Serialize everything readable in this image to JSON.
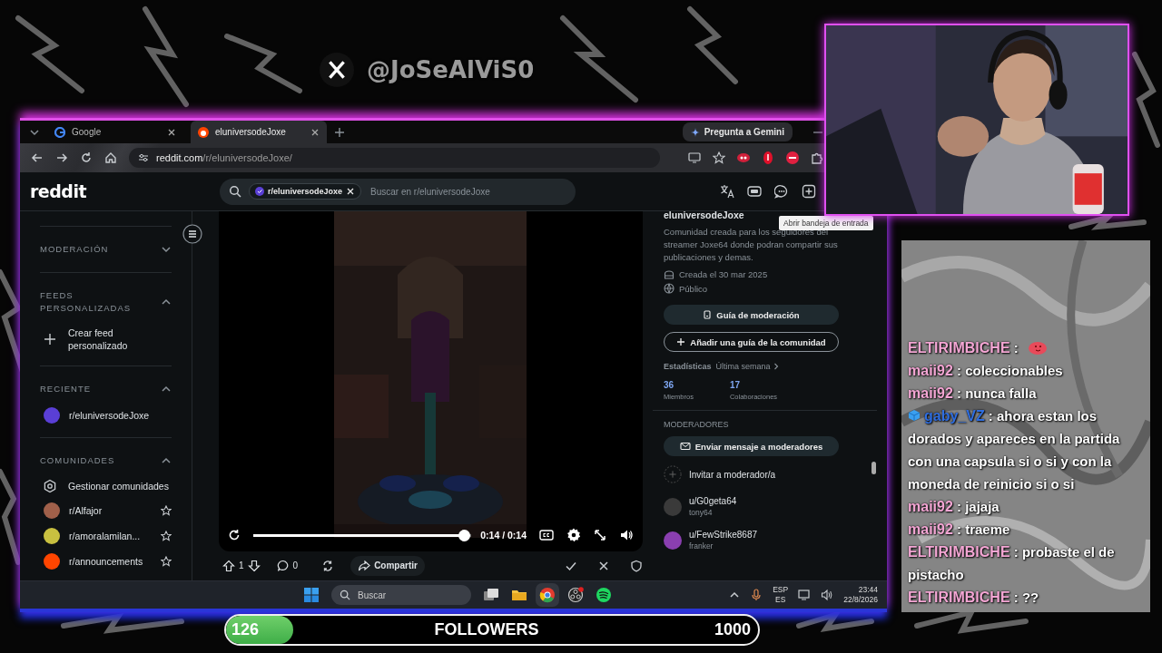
{
  "social": {
    "handle": "@JoSeAlViS0"
  },
  "browser": {
    "tabs": [
      {
        "title": "Google",
        "selected": false
      },
      {
        "title": "eluniversodeJoxe",
        "selected": true
      }
    ],
    "gemini": "Pregunta a Gemini",
    "url": {
      "domain": "reddit.com",
      "path": "/r/eluniversodeJoxe/"
    }
  },
  "reddit": {
    "logo": "reddit",
    "search": {
      "chip": "r/eluniversodeJoxe",
      "placeholder": "Buscar en r/eluniversodeJoxe"
    },
    "tooltip": "Abrir bandeja de entrada",
    "sidebar": [
      {
        "title": "MODERACIÓN",
        "expanded": false
      },
      {
        "title": "FEEDS PERSONALIZADAS",
        "expanded": true,
        "items": [
          {
            "kind": "add",
            "label": "Crear feed personalizado"
          }
        ]
      },
      {
        "title": "RECIENTE",
        "expanded": true,
        "items": [
          {
            "kind": "community",
            "label": "r/eluniversodeJoxe",
            "color": "#5a3fd6"
          }
        ]
      },
      {
        "title": "COMUNIDADES",
        "expanded": true,
        "items": [
          {
            "kind": "settings",
            "label": "Gestionar comunidades"
          },
          {
            "kind": "community",
            "label": "r/Alfajor",
            "color": "#a0604a",
            "favorite": false
          },
          {
            "kind": "community",
            "label": "r/amoralamilan...",
            "color": "#c8c040",
            "favorite": false
          },
          {
            "kind": "community",
            "label": "r/announcements",
            "color": "#ff4500",
            "favorite": false
          }
        ]
      }
    ],
    "video": {
      "time": "0:14 / 0:14",
      "level": 1.0
    },
    "post": {
      "votes": "1",
      "comments": "0",
      "share": "Compartir"
    },
    "about": {
      "name": "eluniversodeJoxe",
      "description": "Comunidad creada para los seguidores del streamer Joxe64 donde podran compartir sus publicaciones y demas.",
      "created": "Creada el 30 mar 2025",
      "visibility": "Público",
      "buttons": [
        {
          "label": "Guía de moderación",
          "kind": "filled"
        },
        {
          "label": "Añadir una guía de la comunidad",
          "kind": "outline"
        }
      ],
      "stats_label": "Estadísticas",
      "period": "Última semana",
      "stats": [
        {
          "value": "36",
          "label": "Miembros"
        },
        {
          "value": "17",
          "label": "Colaboraciones"
        }
      ],
      "moderators_title": "MODERADORES",
      "message_button": "Enviar mensaje a moderadores",
      "invite": "Invitar a moderador/a",
      "moderators": [
        {
          "user": "u/G0geta64",
          "flair": "tony64",
          "color": "#3a3a3a"
        },
        {
          "user": "u/FewStrike8687",
          "flair": "franker",
          "color": "#8a3fb0"
        }
      ]
    }
  },
  "taskbar": {
    "search": "Buscar",
    "lang": "ESP",
    "region": "ES",
    "time": "23:44",
    "date": "22/8/2026"
  },
  "chat": [
    {
      "user": "ELTIRIMBICHE",
      "color": "#f4a6d4",
      "text": ":",
      "emote": true
    },
    {
      "user": "maii92",
      "color": "#f4a6d4",
      "text": ": coleccionables"
    },
    {
      "user": "maii92",
      "color": "#f4a6d4",
      "text": ": nunca falla"
    },
    {
      "user": "gaby_VZ",
      "color": "#2f6ee0",
      "text": ": ahora estan los dorados y apareces en la partida con una capsula si o si y con la moneda de reinicio si o si",
      "badge": true
    },
    {
      "user": "maii92",
      "color": "#f4a6d4",
      "text": ": jajaja"
    },
    {
      "user": "maii92",
      "color": "#f4a6d4",
      "text": ": traeme"
    },
    {
      "user": "ELTIRIMBICHE",
      "color": "#f4a6d4",
      "text": ": probaste el de pistacho"
    },
    {
      "user": "ELTIRIMBICHE",
      "color": "#f4a6d4",
      "text": ": ??"
    }
  ],
  "followers": {
    "current": "126",
    "label": "FOLLOWERS",
    "goal": "1000",
    "level": 0.126
  }
}
